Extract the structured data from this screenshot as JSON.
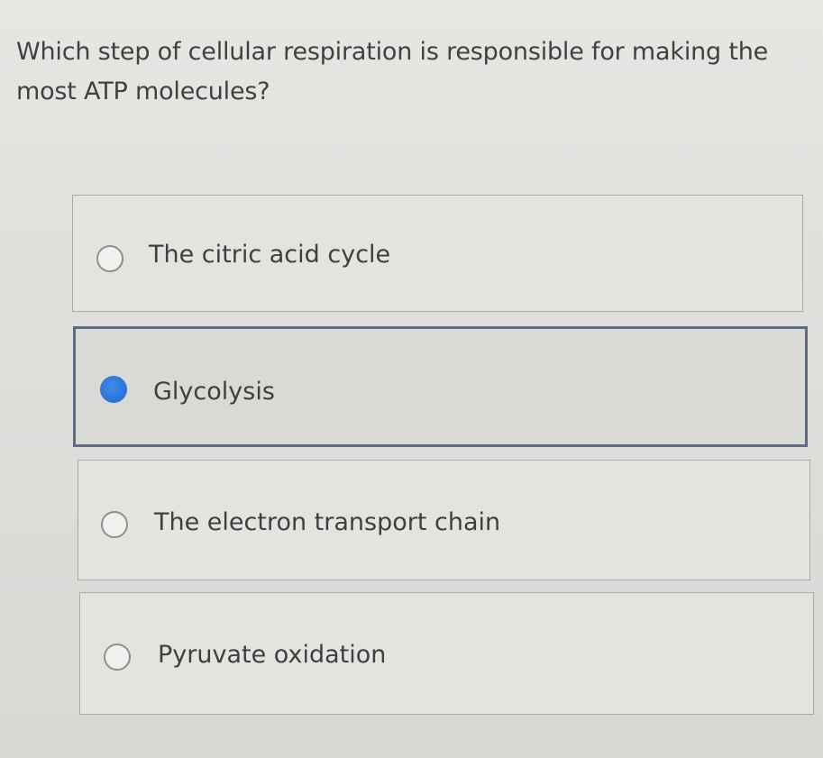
{
  "question": "Which step of cellular respiration is responsible for making the most ATP molecules?",
  "options": [
    {
      "label": "The citric acid cycle",
      "selected": false
    },
    {
      "label": "Glycolysis",
      "selected": true
    },
    {
      "label": "The electron transport chain",
      "selected": false
    },
    {
      "label": "Pyruvate oxidation",
      "selected": false
    }
  ],
  "colors": {
    "selected_radio": "#2a72d8",
    "selected_border": "#5f6b86"
  }
}
